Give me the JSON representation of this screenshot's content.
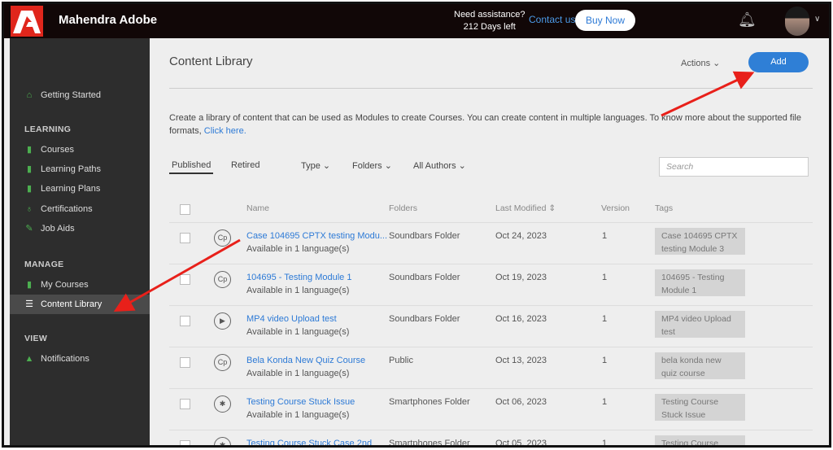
{
  "header": {
    "brand": "Mahendra Adobe",
    "assist": "Need assistance?",
    "days_left": "212 Days left",
    "contact": "Contact us",
    "buy": "Buy Now"
  },
  "sidebar": {
    "getting_started": "Getting Started",
    "learning": "LEARNING",
    "courses": "Courses",
    "learning_paths": "Learning Paths",
    "learning_plans": "Learning Plans",
    "certifications": "Certifications",
    "job_aids": "Job Aids",
    "manage": "MANAGE",
    "my_courses": "My Courses",
    "content_library": "Content Library",
    "view": "VIEW",
    "notifications": "Notifications"
  },
  "main": {
    "title": "Content Library",
    "actions": "Actions",
    "add": "Add",
    "desc": "Create a library of content that can be used as Modules to create Courses. You can create content in multiple languages. To know more about the supported file formats, ",
    "click_here": "Click here.",
    "tabs": {
      "published": "Published",
      "retired": "Retired",
      "type": "Type",
      "folders": "Folders",
      "authors": "All Authors"
    },
    "search_placeholder": "Search",
    "columns": {
      "name": "Name",
      "folders": "Folders",
      "modified": "Last Modified",
      "version": "Version",
      "tags": "Tags"
    },
    "rows": [
      {
        "icon": "Cp",
        "name": "Case 104695 CPTX testing Modu...",
        "sub": "Available in 1 language(s)",
        "folder": "Soundbars Folder",
        "date": "Oct 24, 2023",
        "version": "1",
        "tag": "Case 104695 CPTX testing Module 3"
      },
      {
        "icon": "Cp",
        "name": "104695 - Testing Module 1",
        "sub": "Available in 1 language(s)",
        "folder": "Soundbars Folder",
        "date": "Oct 19, 2023",
        "version": "1",
        "tag": "104695 - Testing Module 1"
      },
      {
        "icon": "▶",
        "name": "MP4 video Upload test",
        "sub": "Available in 1 language(s)",
        "folder": "Soundbars Folder",
        "date": "Oct 16, 2023",
        "version": "1",
        "tag": "MP4 video Upload test"
      },
      {
        "icon": "Cp",
        "name": "Bela Konda New Quiz Course",
        "sub": "Available in 1 language(s)",
        "folder": "Public",
        "date": "Oct 13, 2023",
        "version": "1",
        "tag": "bela konda new quiz course"
      },
      {
        "icon": "✱",
        "name": "Testing Course Stuck Issue",
        "sub": "Available in 1 language(s)",
        "folder": "Smartphones Folder",
        "date": "Oct 06, 2023",
        "version": "1",
        "tag": "Testing Course Stuck Issue"
      },
      {
        "icon": "✱",
        "name": "Testing Course Stuck Case 2nd",
        "sub": "",
        "folder": "Smartphones Folder",
        "date": "Oct 05, 2023",
        "version": "1",
        "tag": "Testing Course"
      }
    ]
  }
}
